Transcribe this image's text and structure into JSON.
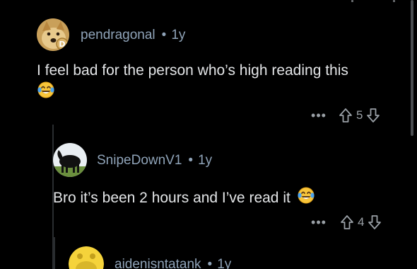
{
  "comments": [
    {
      "username": "pendragonal",
      "separator": "•",
      "age": "1y",
      "text": "I feel bad for the person who’s high reading this",
      "emoji": "tears-of-joy",
      "score": "5",
      "more": "•••",
      "avatar": "doge-avatar"
    },
    {
      "username": "SnipeDownV1",
      "separator": "•",
      "age": "1y",
      "text": "Bro it’s been 2 hours and I’ve read it",
      "emoji": "tears-of-joy",
      "score": "4",
      "more": "•••",
      "avatar": "black-horse-avatar"
    },
    {
      "username": "aidenisntatank",
      "separator": "•",
      "age": "1y",
      "avatar": "yellow-snoo-avatar"
    }
  ],
  "colors": {
    "background": "#000000",
    "username": "#8fa3b8",
    "body_text": "#e3e5e7",
    "icons": "#9aa0a6",
    "thread_line": "#2a2d30"
  }
}
